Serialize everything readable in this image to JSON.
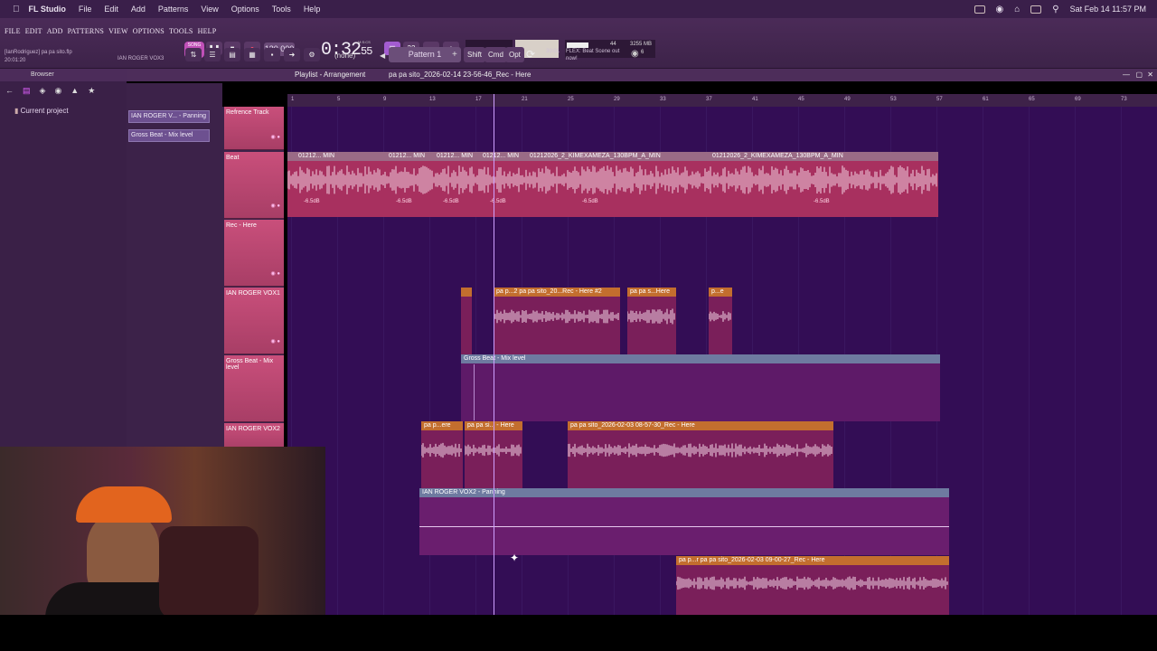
{
  "macbar": {
    "app": "FL Studio",
    "menus": [
      "File",
      "Edit",
      "Add",
      "Patterns",
      "View",
      "Options",
      "Tools",
      "Help"
    ],
    "datetime": "Sat Feb 14  11:57 PM"
  },
  "toolbar": {
    "menu": [
      "FILE",
      "EDIT",
      "ADD",
      "PATTERNS",
      "VIEW",
      "OPTIONS",
      "TOOLS",
      "HELP"
    ],
    "project_user": "[IanRodriguez] pa pa sito.flp",
    "project_time": "20:01:20",
    "track_hint": "IAN ROGER VOX3",
    "song_mode": "SONG",
    "tempo": "130.000",
    "time": "0:32",
    "time_small": "55",
    "time_unit": "M:S:CS",
    "pattern": "Pattern 1",
    "none_label": "(none)",
    "shift": "Shift",
    "cmd": "Cmd",
    "opt": "Opt",
    "cpu_top": "44",
    "memory": "3255 MB",
    "memory_small": "6",
    "flex_time": "30:01",
    "flex_hint": "FLEX: Beat Scene out now!"
  },
  "browser": {
    "title": "Browser",
    "current_project": "Current project"
  },
  "picker": {
    "items": [
      "IAN ROGER V... - Panning",
      "Gross Beat - Mix level"
    ]
  },
  "playlist": {
    "title": "Playlist - Arrangement",
    "song": "pa pa sito_2026-02-14 23-56-46_Rec - Here",
    "ruler": [
      "1",
      "5",
      "9",
      "13",
      "17",
      "21",
      "25",
      "29",
      "33",
      "37",
      "41",
      "45",
      "49",
      "53",
      "57",
      "61",
      "65",
      "69",
      "73"
    ]
  },
  "tracks": [
    {
      "name": "Refrence Track"
    },
    {
      "name": "Beat"
    },
    {
      "name": "Rec - Here"
    },
    {
      "name": "IAN ROGER VOX1"
    },
    {
      "name": "Gross Beat - Mix level"
    },
    {
      "name": "IAN ROGER VOX2"
    }
  ],
  "clips": {
    "beat_a": "01212... MIN",
    "beat_b": "01212... MIN",
    "beat_c": "01212... MIN",
    "beat_d": "01212... MIN",
    "beat_e": "01212026_2_KIMEXAMEZA_130BPM_A_MIN",
    "beat_f": "01212026_2_KIMEXAMEZA_130BPM_A_MIN",
    "db_label": "-6.5dB",
    "vox1_b": "pa p...2",
    "vox1_c": "pa pa sito_20...Rec - Here #2",
    "vox1_d": "pa pa s...Here",
    "vox1_e": "p...e",
    "gross": "Gross Beat - Mix level",
    "vox2_a": "pa p...ere",
    "vox2_b": "pa pa si... - Here",
    "vox2_c": "pa pa sito_2026-02-03 08-57-30_Rec - Here",
    "pan": "IAN ROGER VOX2 - Panning",
    "vox3_a": "pa p...r",
    "vox3_b": "pa pa sito_2026-02-03 09-00-27_Rec - Here"
  },
  "colors": {
    "grid": "#330d55",
    "audio_clip": "#b8356a",
    "audio_head": "#c36e2e",
    "auto_clip": "#6a1e6e",
    "auto_head": "#6e7aa0",
    "track_name": "#c94f7b"
  }
}
